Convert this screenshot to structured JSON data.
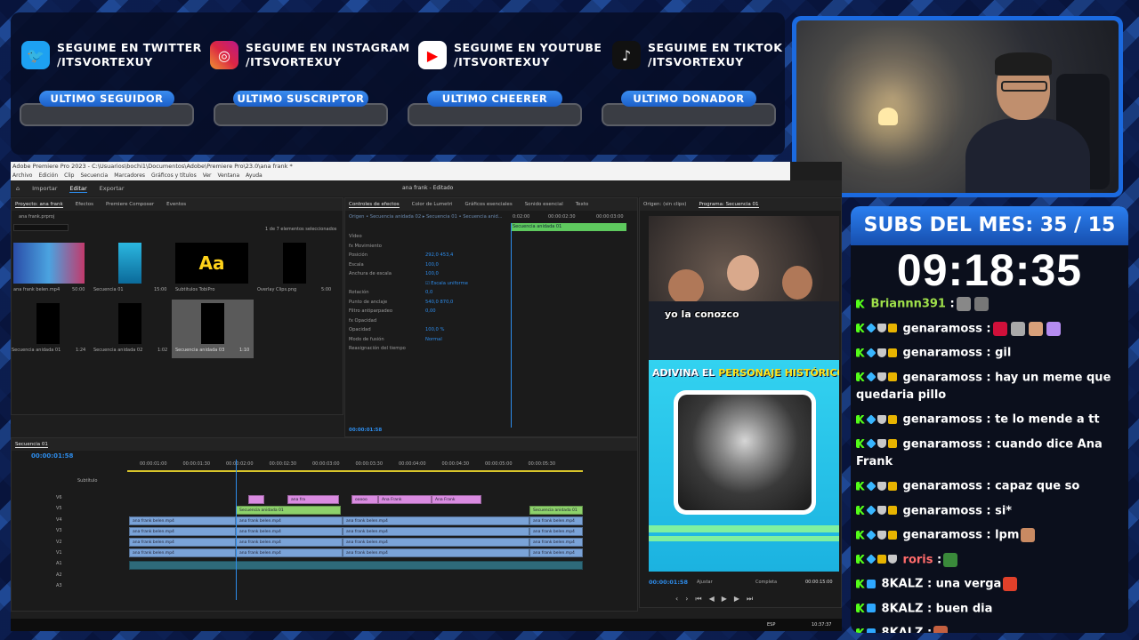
{
  "socials": [
    {
      "platform": "twitter",
      "icon": "twitter-icon",
      "line1": "SEGUIME EN TWITTER",
      "line2": "/ITSVORTEXUY",
      "color": "#1da1f2"
    },
    {
      "platform": "instagram",
      "icon": "instagram-icon",
      "line1": "SEGUIME EN INSTAGRAM",
      "line2": "/ITSVORTEXUY",
      "color": "#d6249f"
    },
    {
      "platform": "youtube",
      "icon": "youtube-icon",
      "line1": "SEGUIME EN YOUTUBE",
      "line2": "/ITSVORTEXUY",
      "color": "#ff0000"
    },
    {
      "platform": "tiktok",
      "icon": "tiktok-icon",
      "line1": "SEGUIME EN TIKTOK",
      "line2": "/ITSVORTEXUY",
      "color": "#111111"
    }
  ],
  "pills": [
    "ULTIMO SEGUIDOR",
    "ULTIMO SUSCRIPTOR",
    "ULTIMO CHEERER",
    "ULTIMO DONADOR"
  ],
  "subs": {
    "title": "SUBS DEL MES: 35 / 15",
    "timer": "09:18:35"
  },
  "chat": [
    {
      "user": "Briannn391",
      "sep": " :",
      "text": "",
      "user_color": "green",
      "emotes": [
        "#888",
        "#777"
      ]
    },
    {
      "user": "genaramoss",
      "sep": " :",
      "text": "",
      "user_color": "white",
      "emotes": [
        "#d0103a",
        "#a9a9a9",
        "#d8a07a",
        "#b58cf0"
      ]
    },
    {
      "user": "genaramoss",
      "sep": " :",
      "text": " gil",
      "user_color": "white",
      "emotes": []
    },
    {
      "user": "genaramoss",
      "sep": " :",
      "text": " hay un meme que quedaria pillo",
      "user_color": "white",
      "emotes": []
    },
    {
      "user": "genaramoss",
      "sep": " :",
      "text": " te lo mende a tt",
      "user_color": "white",
      "emotes": []
    },
    {
      "user": "genaramoss",
      "sep": " :",
      "text": " cuando dice Ana Frank",
      "user_color": "white",
      "emotes": []
    },
    {
      "user": "genaramoss",
      "sep": " :",
      "text": " capaz que so",
      "user_color": "white",
      "emotes": []
    },
    {
      "user": "genaramoss",
      "sep": " :",
      "text": " si*",
      "user_color": "white",
      "emotes": []
    },
    {
      "user": "genaramoss",
      "sep": " :",
      "text": " lpm",
      "user_color": "white",
      "emotes": [
        "#c98a62"
      ]
    },
    {
      "user": "roris",
      "sep": " :",
      "text": "",
      "user_color": "red",
      "emotes": [
        "#3a8a3a"
      ]
    },
    {
      "user": "8KALZ",
      "sep": " :",
      "text": " una verga",
      "user_color": "white",
      "emotes": [
        "#e0402a"
      ]
    },
    {
      "user": "8KALZ",
      "sep": " :",
      "text": " buen dia",
      "user_color": "white",
      "emotes": []
    },
    {
      "user": "8KALZ",
      "sep": " :",
      "text": "",
      "user_color": "white",
      "emotes": [
        "#c46040"
      ]
    }
  ],
  "premiere": {
    "title": "Adobe Premiere Pro 2023 - C:\\Usuarios\\bochi1\\Documentos\\Adobe\\Premiere Pro\\23.0\\ana frank *",
    "menu": [
      "Archivo",
      "Edición",
      "Clip",
      "Secuencia",
      "Marcadores",
      "Gráficos y títulos",
      "Ver",
      "Ventana",
      "Ayuda"
    ],
    "workspace_tabs": [
      "Importar",
      "Editar",
      "Exportar"
    ],
    "doc_title": "ana frank - Editado",
    "project": {
      "tabs": [
        "Proyecto: ana frank",
        "Efectos",
        "Premiere Composer",
        "Eventos"
      ],
      "file": "ana frank.prproj",
      "count": "1 de 7 elementos seleccionados",
      "items": [
        {
          "name": "ana frank belen.mp4",
          "dur": "50:00"
        },
        {
          "name": "Secuencia 01",
          "dur": "15:00"
        },
        {
          "name": "Subtitulos TobiPro",
          "dur": "",
          "thumb_text": "Aa"
        },
        {
          "name": "Overlay Clips.png",
          "dur": "5:00"
        },
        {
          "name": "Secuencia anidada 01",
          "dur": "1:24"
        },
        {
          "name": "Secuencia anidada 02",
          "dur": "1:02"
        },
        {
          "name": "Secuencia anidada 03",
          "dur": "1:10"
        }
      ]
    },
    "effects": {
      "tabs": [
        "Controles de efectos",
        "Color de Lumetri",
        "Gráficos esenciales",
        "Sonido esencial",
        "Texto"
      ],
      "source_row": "Origen • Secuencia anidada 02  ▸  Secuencia 01 • Secuencia anid...",
      "ruler": [
        "0:02:00",
        "00:00:02:30",
        "00:00:03:00"
      ],
      "clip_label": "Secuencia anidada 01",
      "rows": [
        {
          "label": "Vídeo",
          "value": ""
        },
        {
          "label": "fx  Movimiento",
          "value": ""
        },
        {
          "label": "Posición",
          "value": "292,0    453,4"
        },
        {
          "label": "Escala",
          "value": "100,0"
        },
        {
          "label": "Anchura de escala",
          "value": "100,0"
        },
        {
          "label": "",
          "value": "☑ Escala uniforme"
        },
        {
          "label": "Rotación",
          "value": "0,0"
        },
        {
          "label": "Punto de anclaje",
          "value": "540,0    870,0"
        },
        {
          "label": "Filtro antiparpadeo",
          "value": "0,00"
        },
        {
          "label": "fx  Opacidad",
          "value": ""
        },
        {
          "label": "Opacidad",
          "value": "100,0 %"
        },
        {
          "label": "Modo de fusión",
          "value": "Normal"
        },
        {
          "label": "Reasignación del tiempo",
          "value": ""
        }
      ],
      "timecode": "00:00:01:58"
    },
    "program": {
      "tabs": [
        "Origen: (sin clips)",
        "Programa: Secuencia 01"
      ],
      "caption": "yo la conozco",
      "banner_a": "ADIVINA EL ",
      "banner_b": "PERSONAJE HISTÓRICO",
      "timecode": "00:00:01:58",
      "fit": "Ajustar",
      "quality": "Completa",
      "duration": "00:00:15:00"
    },
    "timeline": {
      "seq": "Secuencia 01",
      "timecode": "00:00:01:58",
      "ruler": [
        "00:00:01:00",
        "00:00:01:30",
        "00:00:02:00",
        "00:00:02:30",
        "00:00:03:00",
        "00:00:03:30",
        "00:00:04:00",
        "00:00:04:30",
        "00:00:05:00",
        "00:00:05:30"
      ],
      "sub_track": "Subtítulo",
      "v_tracks": [
        "V6",
        "V5",
        "V4",
        "V3",
        "V2",
        "V1"
      ],
      "a_tracks": [
        "A1",
        "A2",
        "A3"
      ],
      "clip_blue": "ana frank belen.mp4",
      "clip_green": "Secuencia anidada 01",
      "pink_clips": [
        "ana fra",
        "ooooo",
        "Ana Frank",
        "Ana Frank"
      ]
    },
    "taskbar": {
      "lang": "ESP",
      "clock": "10:37:37"
    }
  }
}
